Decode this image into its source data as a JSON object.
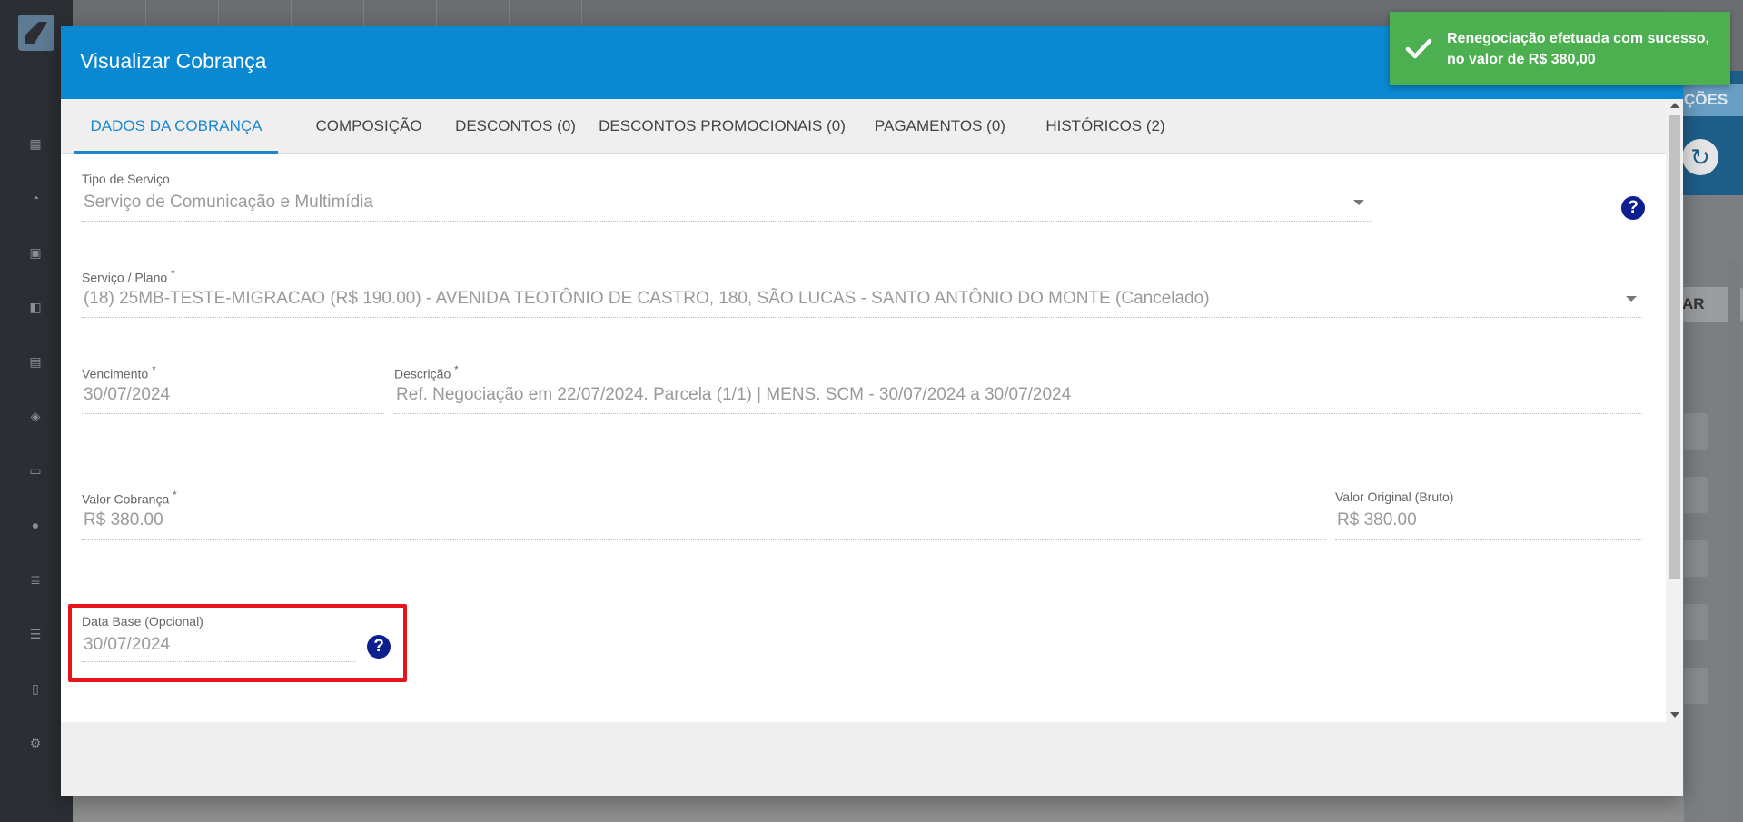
{
  "modal": {
    "title": "Visualizar Cobrança",
    "tabs": [
      {
        "label": "DADOS DA COBRANÇA",
        "active": true
      },
      {
        "label": "COMPOSIÇÃO",
        "active": false
      },
      {
        "label": "DESCONTOS (0)",
        "active": false
      },
      {
        "label": "DESCONTOS PROMOCIONAIS (0)",
        "active": false
      },
      {
        "label": "PAGAMENTOS (0)",
        "active": false
      },
      {
        "label": "HISTÓRICOS (2)",
        "active": false
      }
    ],
    "fields": {
      "tipo_servico": {
        "label": "Tipo de Serviço",
        "value": "Serviço de Comunicação e Multimídia"
      },
      "servico_plano": {
        "label": "Serviço / Plano",
        "value": "(18) 25MB-TESTE-MIGRACAO (R$ 190.00) - AVENIDA TEOTÔNIO DE CASTRO, 180, SÃO LUCAS - SANTO ANTÔNIO DO MONTE (Cancelado)"
      },
      "vencimento": {
        "label": "Vencimento",
        "value": "30/07/2024"
      },
      "descricao": {
        "label": "Descrição",
        "value": "Ref. Negociação em 22/07/2024. Parcela (1/1) | MENS. SCM - 30/07/2024 a 30/07/2024"
      },
      "valor_cobranca": {
        "label": "Valor Cobrança",
        "value": "R$ 380.00"
      },
      "valor_original": {
        "label": "Valor Original (Bruto)",
        "value": "R$ 380.00"
      },
      "data_base": {
        "label": "Data Base (Opcional)",
        "value": "30/07/2024"
      }
    },
    "required_marker": "*",
    "help_glyph": "?"
  },
  "toast": {
    "message": "Renegociação efetuada com sucesso, no valor de R$ 380,00",
    "icon": "check-icon"
  },
  "background": {
    "acoes_label": "ÇÕES",
    "ar_label": "AR"
  },
  "colors": {
    "header_blue": "#0a88d1",
    "tab_active": "#1a87cf",
    "help_icon": "#0b1f8f",
    "toast_green": "#4caf50",
    "highlight_red": "#e8141b"
  }
}
